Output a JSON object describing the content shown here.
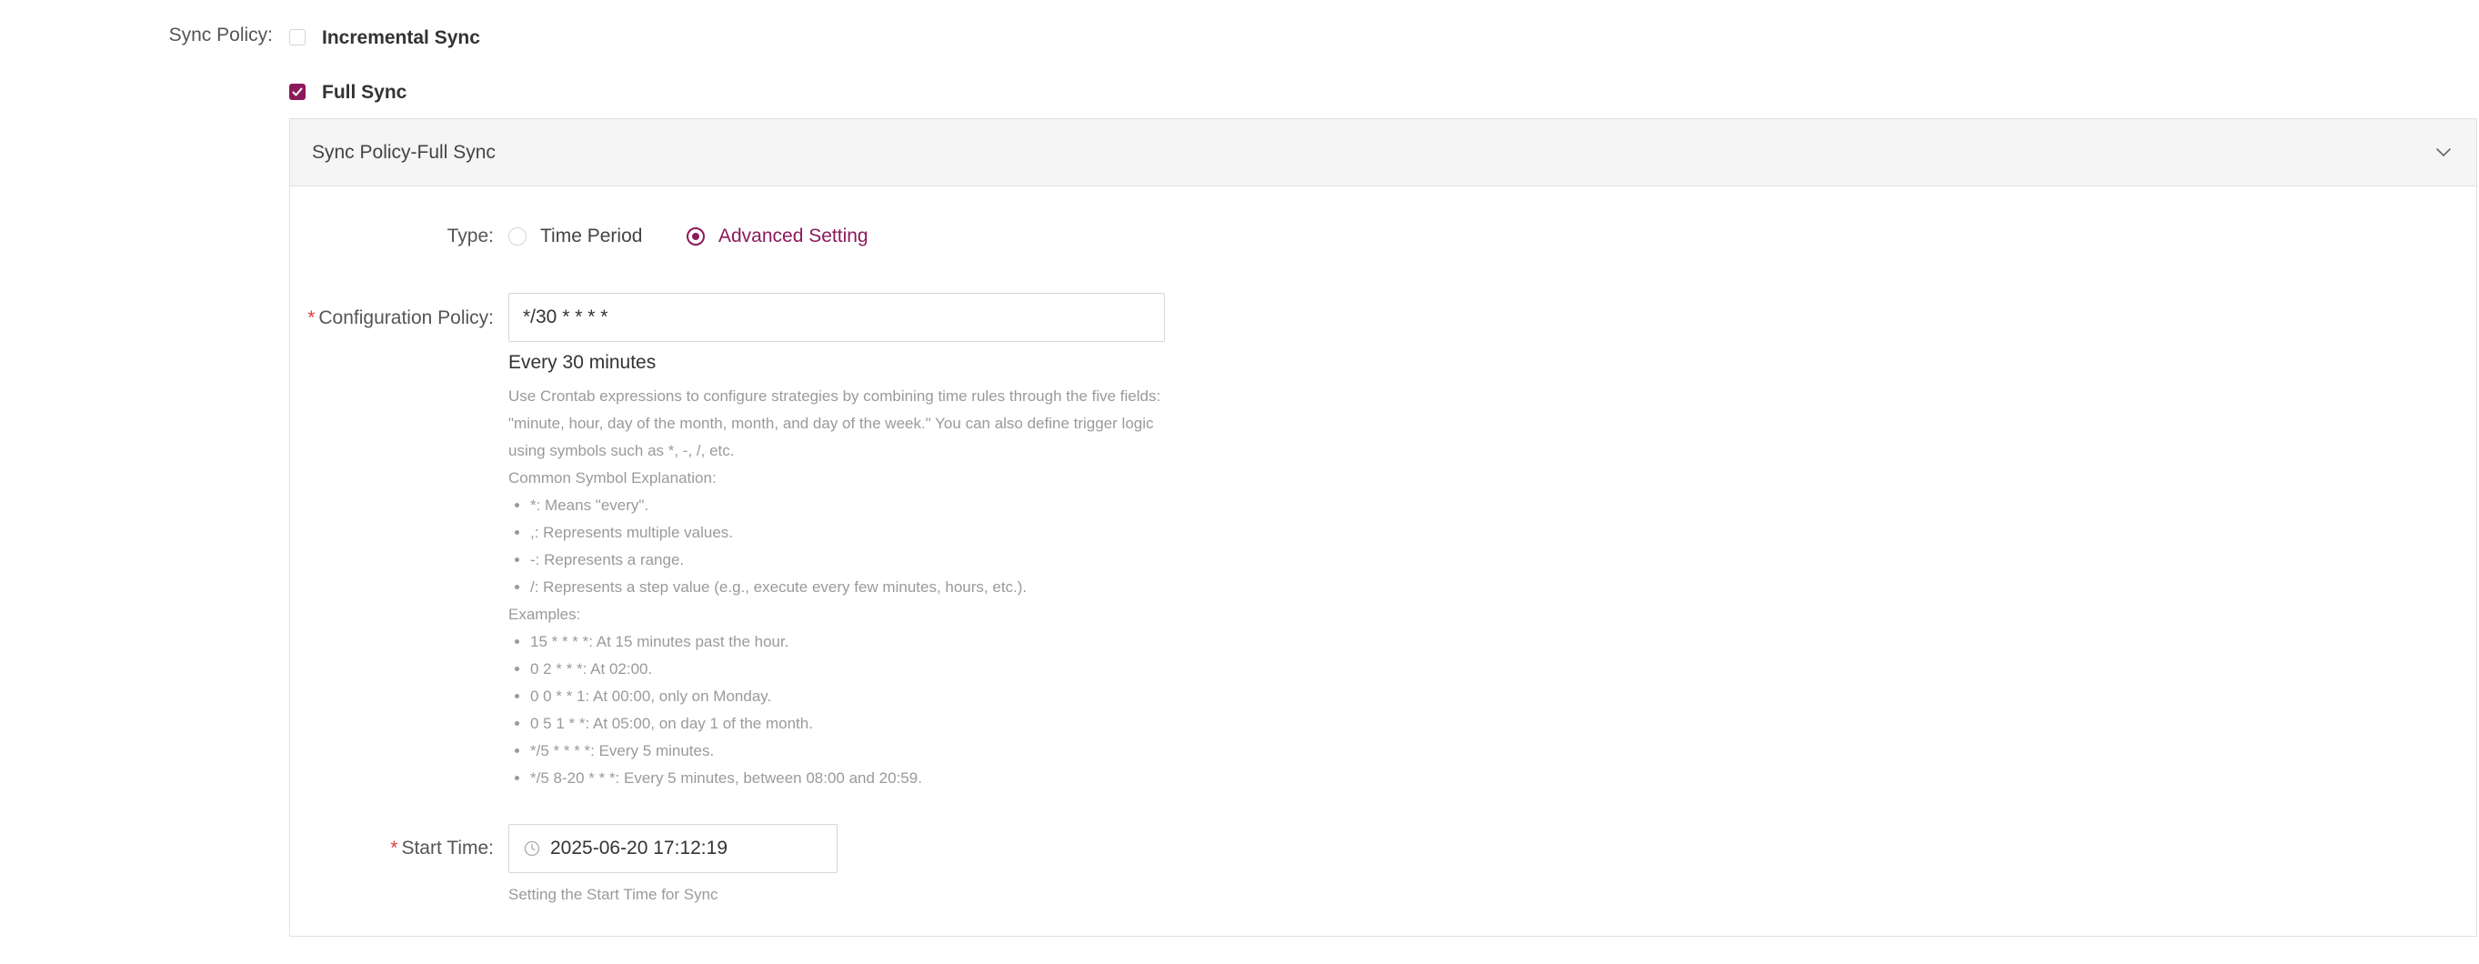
{
  "sync_policy": {
    "label": "Sync Policy:",
    "options": [
      {
        "label": "Incremental Sync",
        "checked": false
      },
      {
        "label": "Full Sync",
        "checked": true
      }
    ]
  },
  "panel": {
    "title": "Sync Policy-Full Sync",
    "type": {
      "label": "Type:",
      "options": [
        {
          "label": "Time Period",
          "selected": false
        },
        {
          "label": "Advanced Setting",
          "selected": true
        }
      ]
    },
    "configuration_policy": {
      "required_mark": "*",
      "label": "Configuration Policy:",
      "value": "*/30 * * * *",
      "description": "Every 30 minutes",
      "help_intro": "Use Crontab expressions to configure strategies by combining time rules through the five fields: \"minute, hour, day of the month, month, and day of the week.\" You can also define trigger logic using symbols such as *, -, /, etc.",
      "symbols_heading": "Common Symbol Explanation:",
      "symbols": [
        "*: Means \"every\".",
        ",: Represents multiple values.",
        "-: Represents a range.",
        "/: Represents a step value (e.g., execute every few minutes, hours, etc.)."
      ],
      "examples_heading": "Examples:",
      "examples": [
        "15 * * * *: At 15 minutes past the hour.",
        "0 2 * * *: At 02:00.",
        "0 0 * * 1: At 00:00, only on Monday.",
        "0 5 1 * *: At 05:00, on day 1 of the month.",
        "*/5 * * * *: Every 5 minutes.",
        "*/5 8-20 * * *: Every 5 minutes, between 08:00 and 20:59."
      ]
    },
    "start_time": {
      "required_mark": "*",
      "label": "Start Time:",
      "value": "2025-06-20 17:12:19",
      "help": "Setting the Start Time for Sync"
    }
  },
  "colors": {
    "accent": "#8b1a5c",
    "required": "#e23d3d",
    "help_text": "#9a9a9a"
  },
  "icons": {
    "checkmark": "check-icon",
    "collapse": "chevron-down-icon",
    "clock": "clock-icon"
  }
}
